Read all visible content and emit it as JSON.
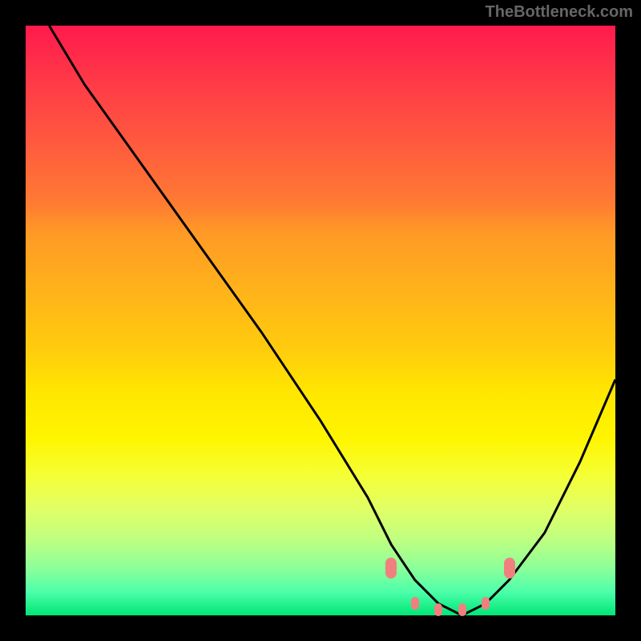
{
  "attribution": "TheBottleneck.com",
  "chart_data": {
    "type": "line",
    "title": "",
    "xlabel": "",
    "ylabel": "",
    "x_range": [
      0,
      100
    ],
    "y_range": [
      0,
      100
    ],
    "series": [
      {
        "name": "curve",
        "x": [
          4,
          10,
          20,
          30,
          40,
          50,
          58,
          62,
          66,
          70,
          74,
          78,
          82,
          88,
          94,
          100
        ],
        "y": [
          100,
          90,
          76,
          62,
          48,
          33,
          20,
          12,
          6,
          2,
          0,
          2,
          6,
          14,
          26,
          40
        ]
      }
    ],
    "markers": {
      "left_edge": {
        "x": 62,
        "y": 8
      },
      "right_edge": {
        "x": 82,
        "y": 8
      },
      "bottom": [
        {
          "x": 66,
          "y": 2
        },
        {
          "x": 70,
          "y": 1
        },
        {
          "x": 74,
          "y": 1
        },
        {
          "x": 78,
          "y": 2
        }
      ]
    },
    "gradient_stops": [
      {
        "pos": 0,
        "color": "#ff1a4d"
      },
      {
        "pos": 50,
        "color": "#ffcc0d"
      },
      {
        "pos": 100,
        "color": "#00e676"
      }
    ]
  }
}
